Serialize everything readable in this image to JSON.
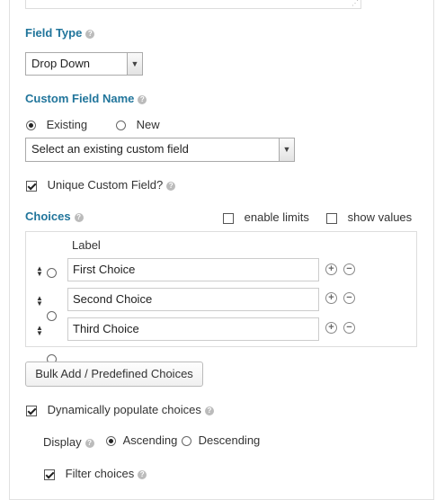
{
  "field_type": {
    "heading": "Field Type",
    "selected": "Drop Down"
  },
  "custom_field_name": {
    "heading": "Custom Field Name",
    "option_existing": "Existing",
    "option_new": "New",
    "selected_mode": "Existing",
    "select_value": "Select an existing custom field"
  },
  "unique_custom_field": {
    "label": "Unique Custom Field?",
    "checked": true
  },
  "choices": {
    "heading": "Choices",
    "enable_limits_label": "enable limits",
    "show_values_label": "show values",
    "column_label": "Label",
    "items": [
      {
        "value": "First Choice"
      },
      {
        "value": "Second Choice"
      },
      {
        "value": "Third Choice"
      }
    ]
  },
  "bulk_add_button": "Bulk Add / Predefined Choices",
  "dynamic": {
    "label": "Dynamically populate choices",
    "checked": true,
    "display_label": "Display",
    "option_ascending": "Ascending",
    "option_descending": "Descending",
    "selected_order": "Ascending",
    "filter_label": "Filter choices",
    "filter_checked": true
  },
  "colors": {
    "heading": "#21759b",
    "border": "#dddddd"
  },
  "icons": [
    "help-icon",
    "dropdown-arrow-icon",
    "sort-handle-icon",
    "add-icon",
    "remove-icon",
    "resize-grip-icon"
  ]
}
